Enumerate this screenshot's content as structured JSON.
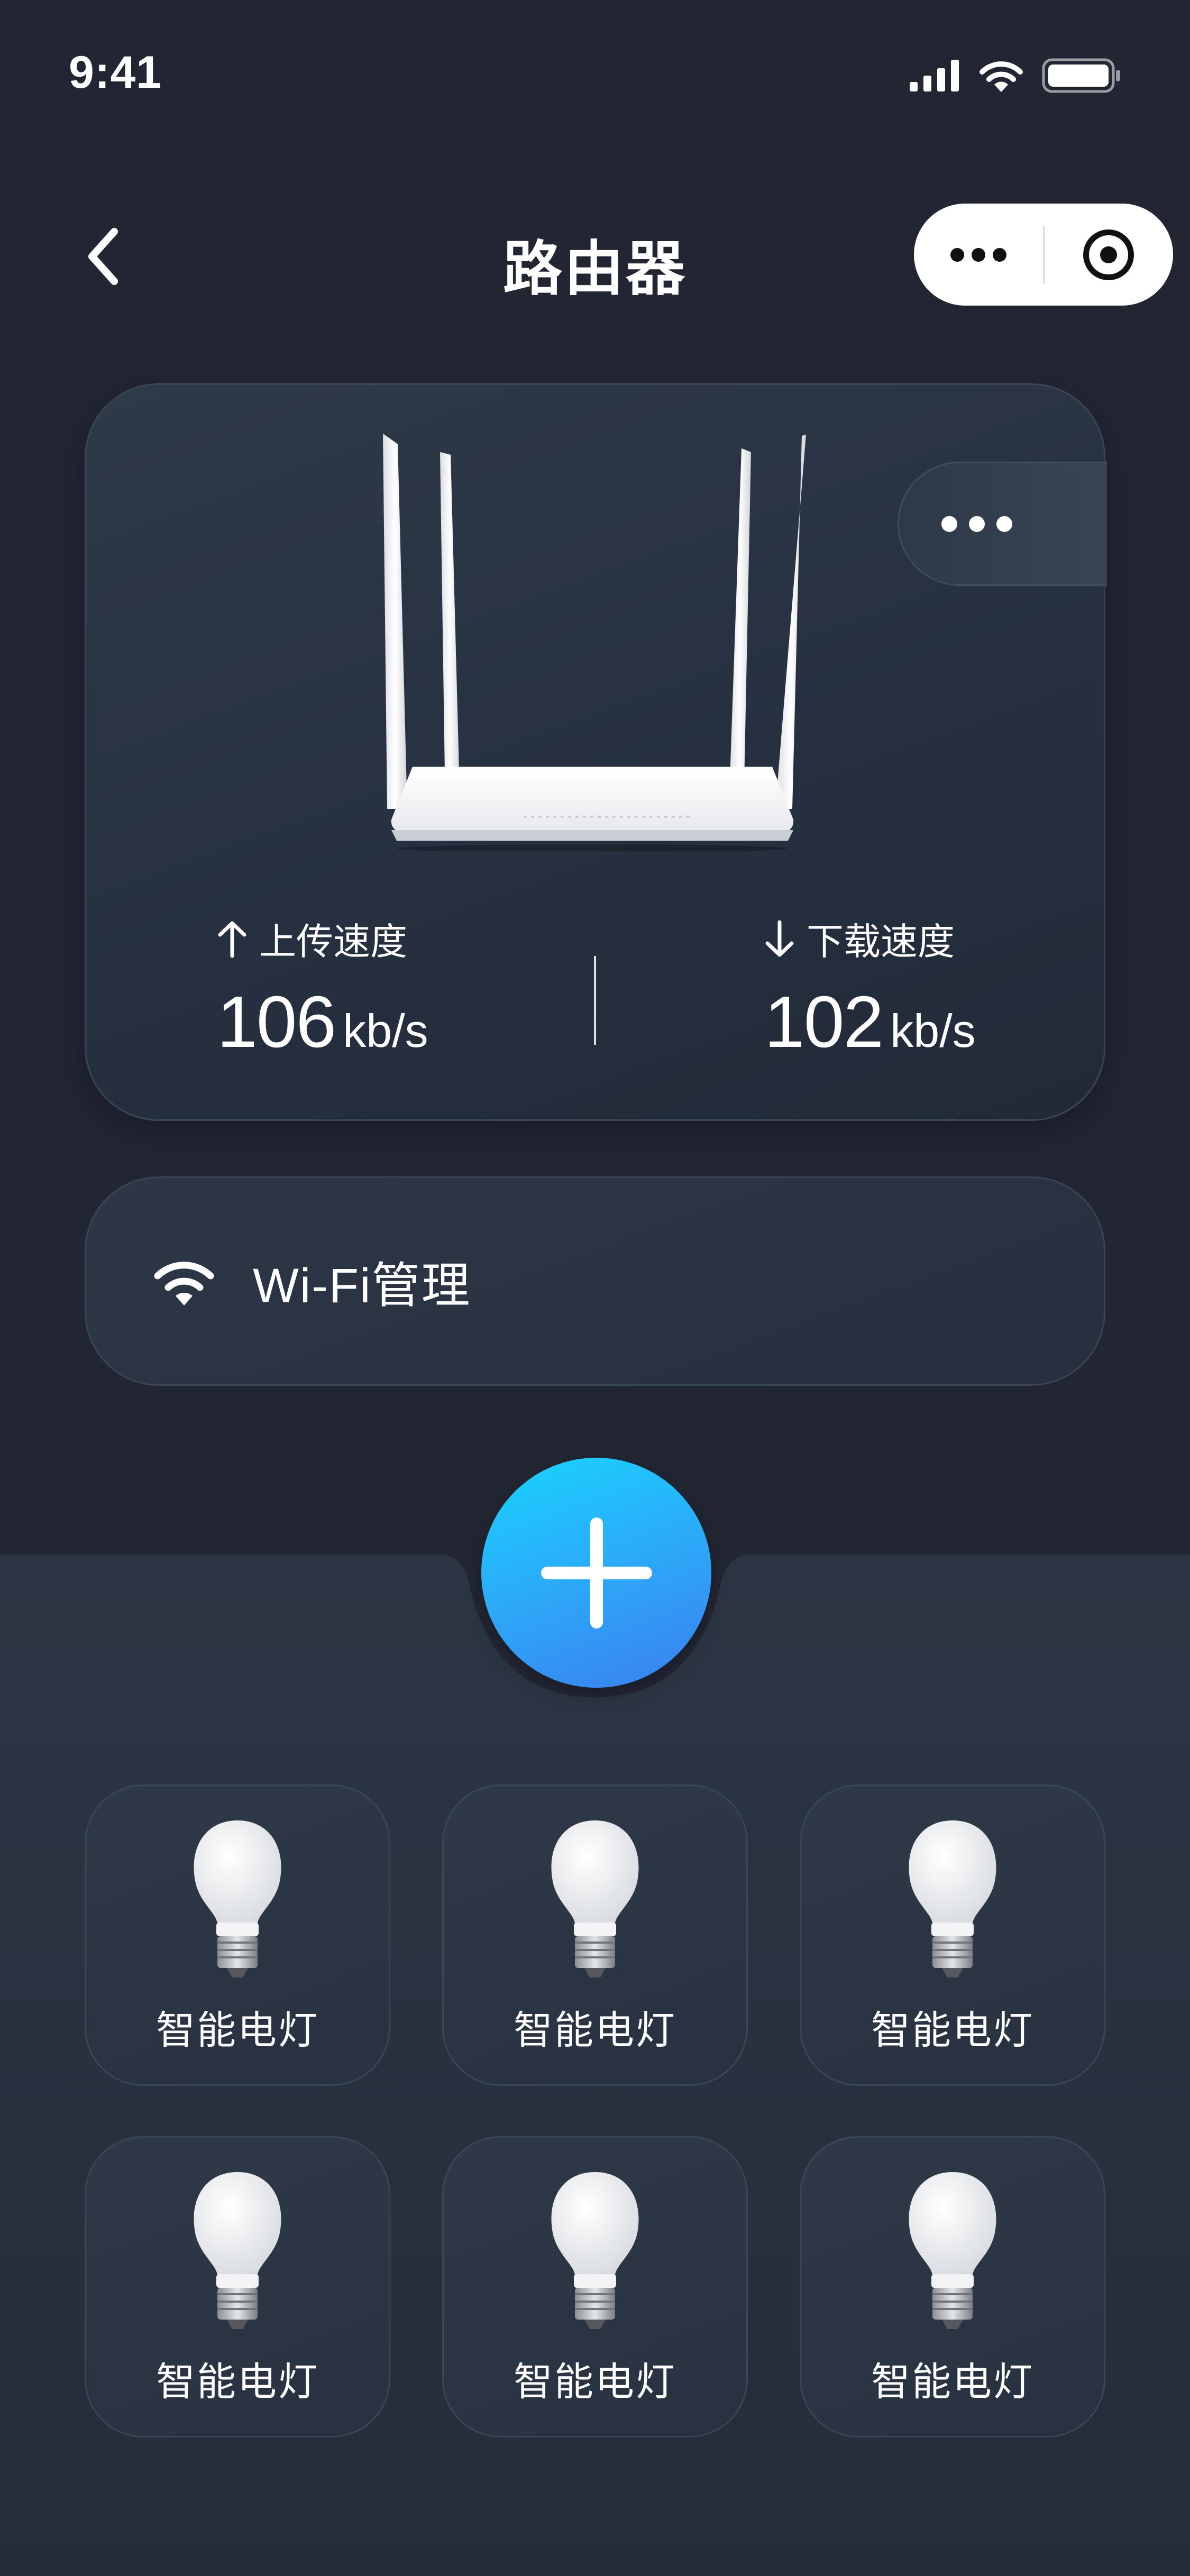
{
  "status_bar": {
    "time": "9:41"
  },
  "nav": {
    "title": "路由器"
  },
  "router": {
    "upload": {
      "label": "上传速度",
      "value": "106",
      "unit": "kb/s"
    },
    "download": {
      "label": "下载速度",
      "value": "102",
      "unit": "kb/s"
    }
  },
  "wifi": {
    "label": "Wi-Fi管理"
  },
  "devices": [
    {
      "label": "智能电灯"
    },
    {
      "label": "智能电灯"
    },
    {
      "label": "智能电灯"
    },
    {
      "label": "智能电灯"
    },
    {
      "label": "智能电灯"
    },
    {
      "label": "智能电灯"
    }
  ],
  "colors": {
    "background": "#222633",
    "card": "#2a3341",
    "accent_start": "#19d4ff",
    "accent_end": "#3b7ef0"
  },
  "icons": {
    "back": "chevron-left-icon",
    "capsule_menu": "more-dots-icon",
    "capsule_close": "target-circle-icon",
    "upload": "arrow-up-icon",
    "download": "arrow-down-icon",
    "wifi": "wifi-icon",
    "add": "plus-icon",
    "device": "light-bulb-icon"
  }
}
